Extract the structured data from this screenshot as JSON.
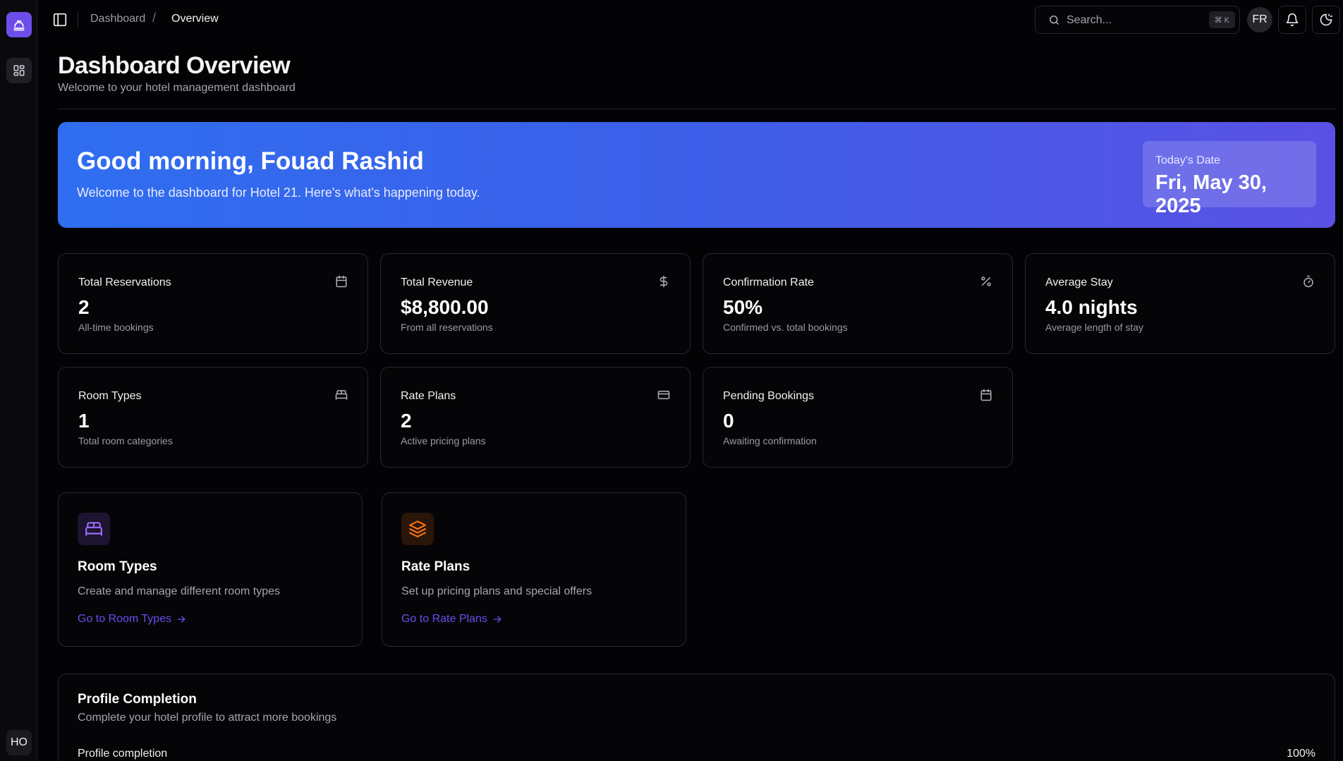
{
  "sidebar": {
    "logo_icon": "hotel-bell-icon",
    "nav_icon": "grid-icon",
    "user_initials": "HO"
  },
  "topbar": {
    "breadcrumb": [
      "Dashboard",
      "Overview"
    ],
    "breadcrumb_separator": "/",
    "search_placeholder": "Search...",
    "search_shortcut": "⌘ K",
    "avatar_initials": "FR",
    "bell_icon": "bell-icon",
    "theme_icon": "theme-toggle-icon"
  },
  "header": {
    "title": "Dashboard Overview",
    "subtitle": "Welcome to your hotel management dashboard"
  },
  "hero": {
    "greeting": "Good morning, Fouad Rashid",
    "message": "Welcome to the dashboard for Hotel 21. Here's what's happening today.",
    "date_label": "Today's Date",
    "date_value": "Fri, May 30, 2025"
  },
  "stats": [
    {
      "label": "Total Reservations",
      "value": "2",
      "desc": "All-time bookings",
      "icon": "calendar-icon"
    },
    {
      "label": "Total Revenue",
      "value": "$8,800.00",
      "desc": "From all reservations",
      "icon": "dollar-icon"
    },
    {
      "label": "Confirmation Rate",
      "value": "50%",
      "desc": "Confirmed vs. total bookings",
      "icon": "percent-icon"
    },
    {
      "label": "Average Stay",
      "value": "4.0 nights",
      "desc": "Average length of stay",
      "icon": "timer-icon"
    },
    {
      "label": "Room Types",
      "value": "1",
      "desc": "Total room categories",
      "icon": "bed-icon"
    },
    {
      "label": "Rate Plans",
      "value": "2",
      "desc": "Active pricing plans",
      "icon": "credit-card-icon"
    },
    {
      "label": "Pending Bookings",
      "value": "0",
      "desc": "Awaiting confirmation",
      "icon": "calendar-icon"
    }
  ],
  "features": [
    {
      "title": "Room Types",
      "desc": "Create and manage different room types",
      "link": "Go to Room Types",
      "icon": "bed-icon",
      "accent": "#8b5cf6"
    },
    {
      "title": "Rate Plans",
      "desc": "Set up pricing plans and special offers",
      "link": "Go to Rate Plans",
      "icon": "layers-icon",
      "accent": "#f97316"
    }
  ],
  "profile": {
    "title": "Profile Completion",
    "subtitle": "Complete your hotel profile to attract more bookings",
    "progress_label": "Profile completion",
    "progress_value": "100%",
    "progress_fraction": 1.0
  },
  "colors": {
    "accent_purple": "#6d4ee8",
    "link": "#6a4df0",
    "hero_start": "#2f6ef0",
    "hero_end": "#5a51e4"
  }
}
